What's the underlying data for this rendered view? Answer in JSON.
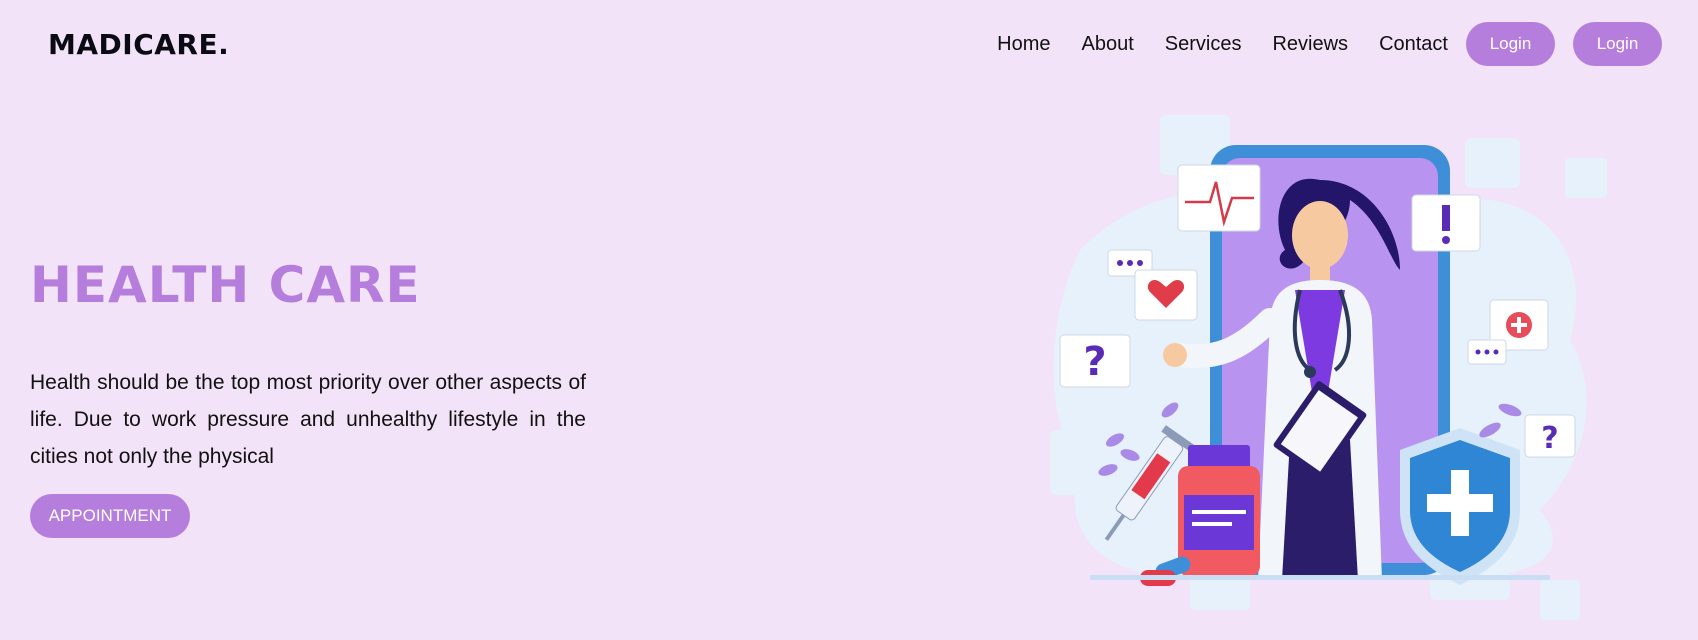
{
  "header": {
    "logo": "MADICARE.",
    "nav": [
      "Home",
      "About",
      "Services",
      "Reviews",
      "Contact"
    ],
    "login_buttons": [
      "Login",
      "Login"
    ]
  },
  "hero": {
    "title": "HEALTH CARE",
    "text": "Health should be the top most priority over other aspects of life. Due to work pressure and unhealthy lifestyle in the cities not only the physical",
    "cta": "APPOINTMENT"
  },
  "illustration": {
    "subject": "doctor-phone-illustration",
    "icons": [
      "heartbeat-monitor-icon",
      "heart-icon",
      "question-icon",
      "exclamation-icon",
      "plus-icon",
      "shield-cross-icon",
      "syringe-icon",
      "medicine-bottle-icon",
      "pills-icon"
    ]
  },
  "colors": {
    "background": "#f3e3f8",
    "accent": "#b57ddc",
    "text": "#111111"
  }
}
